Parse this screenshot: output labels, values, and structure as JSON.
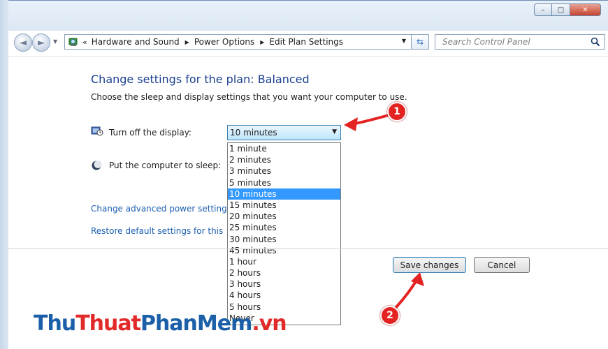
{
  "window": {
    "controls": {
      "minimize": "–",
      "maximize": "□",
      "close": "✕"
    }
  },
  "navigation": {
    "back_glyph": "◄",
    "forward_glyph": "►",
    "breadcrumbs": [
      "Hardware and Sound",
      "Power Options",
      "Edit Plan Settings"
    ],
    "overflow": "«",
    "search_placeholder": "Search Control Panel"
  },
  "content": {
    "title": "Change settings for the plan: Balanced",
    "subtitle": "Choose the sleep and display settings that you want your computer to use.",
    "display_label": "Turn off the display:",
    "sleep_label": "Put the computer to sleep:",
    "display_value": "10 minutes",
    "options": [
      "1 minute",
      "2 minutes",
      "3 minutes",
      "5 minutes",
      "10 minutes",
      "15 minutes",
      "20 minutes",
      "25 minutes",
      "30 minutes",
      "45 minutes",
      "1 hour",
      "2 hours",
      "3 hours",
      "4 hours",
      "5 hours",
      "Never"
    ],
    "selected_index": 4,
    "link_advanced": "Change advanced power settings",
    "link_restore": "Restore default settings for this plan",
    "save_label": "Save changes",
    "cancel_label": "Cancel"
  },
  "annotations": {
    "badge1": "1",
    "badge2": "2",
    "color": "#e32222"
  },
  "watermark": {
    "part1": "Thu",
    "part2": "Thuat",
    "part3": "PhanMem",
    "part4": ".vn"
  }
}
